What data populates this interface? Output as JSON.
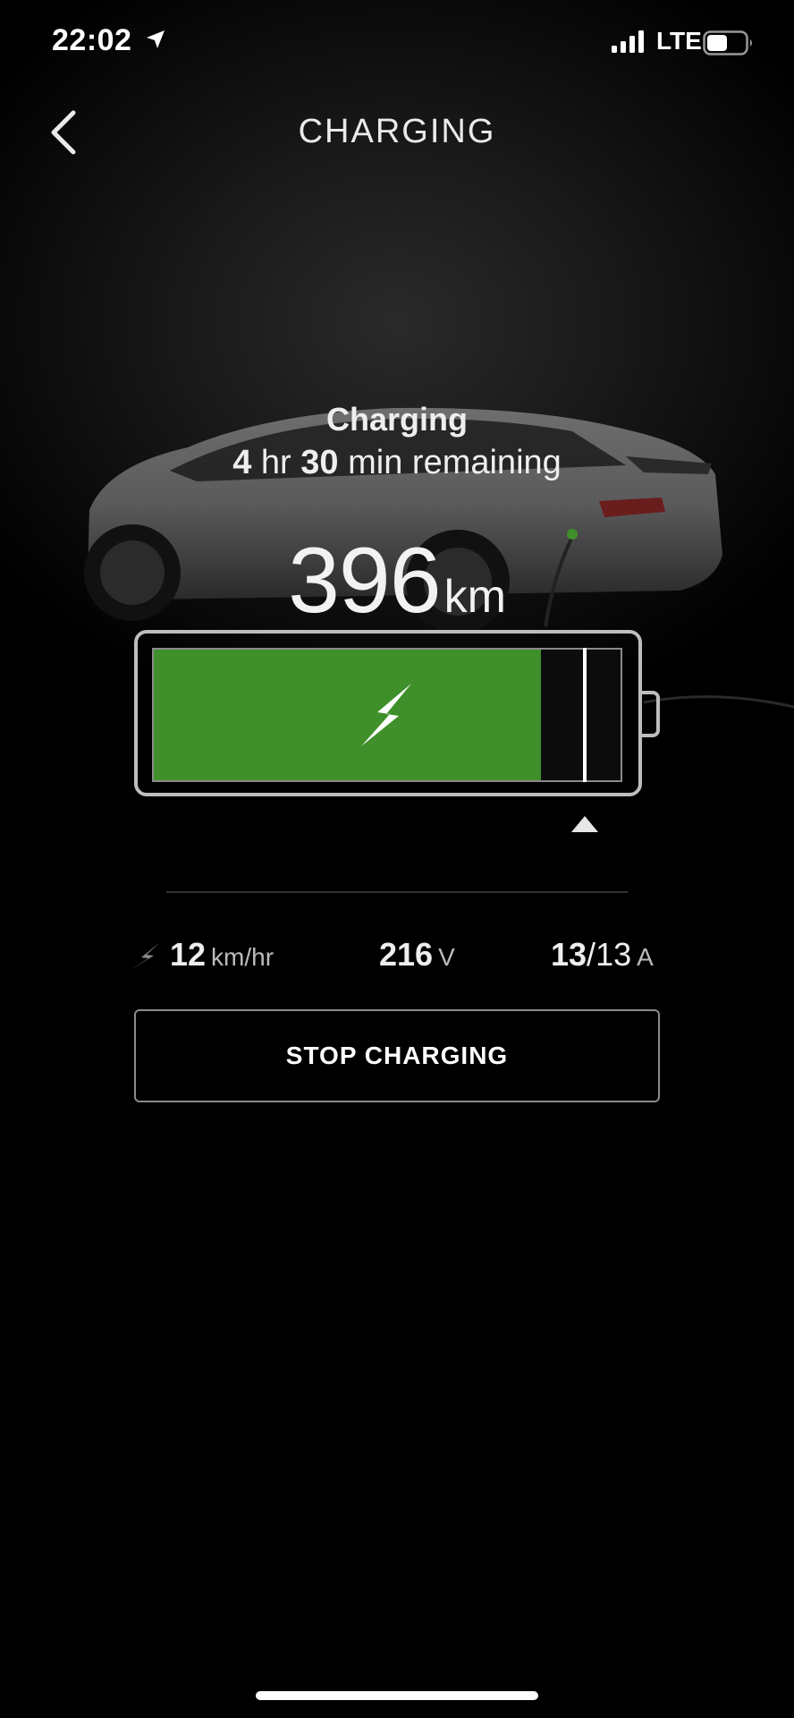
{
  "status_bar": {
    "time": "22:02",
    "network": "LTE",
    "icons": [
      "location-arrow-icon",
      "cell-signal-icon",
      "battery-icon"
    ]
  },
  "header": {
    "title": "CHARGING",
    "back_icon": "chevron-left-icon"
  },
  "charging": {
    "status": "Charging",
    "remaining": {
      "hours": "4",
      "hours_label": "hr",
      "minutes": "30",
      "minutes_label": "min remaining"
    },
    "range_value": "396",
    "range_unit": "km",
    "battery_fill_fraction": 0.83,
    "charge_limit_fraction": 0.92,
    "fill_color": "#3f8f2a"
  },
  "stats": {
    "rate_value": "12",
    "rate_unit": "km/hr",
    "voltage_value": "216",
    "voltage_unit": "V",
    "current_value": "13",
    "current_separator": "/",
    "current_max": "13",
    "current_unit": "A"
  },
  "actions": {
    "stop_label": "STOP CHARGING"
  }
}
